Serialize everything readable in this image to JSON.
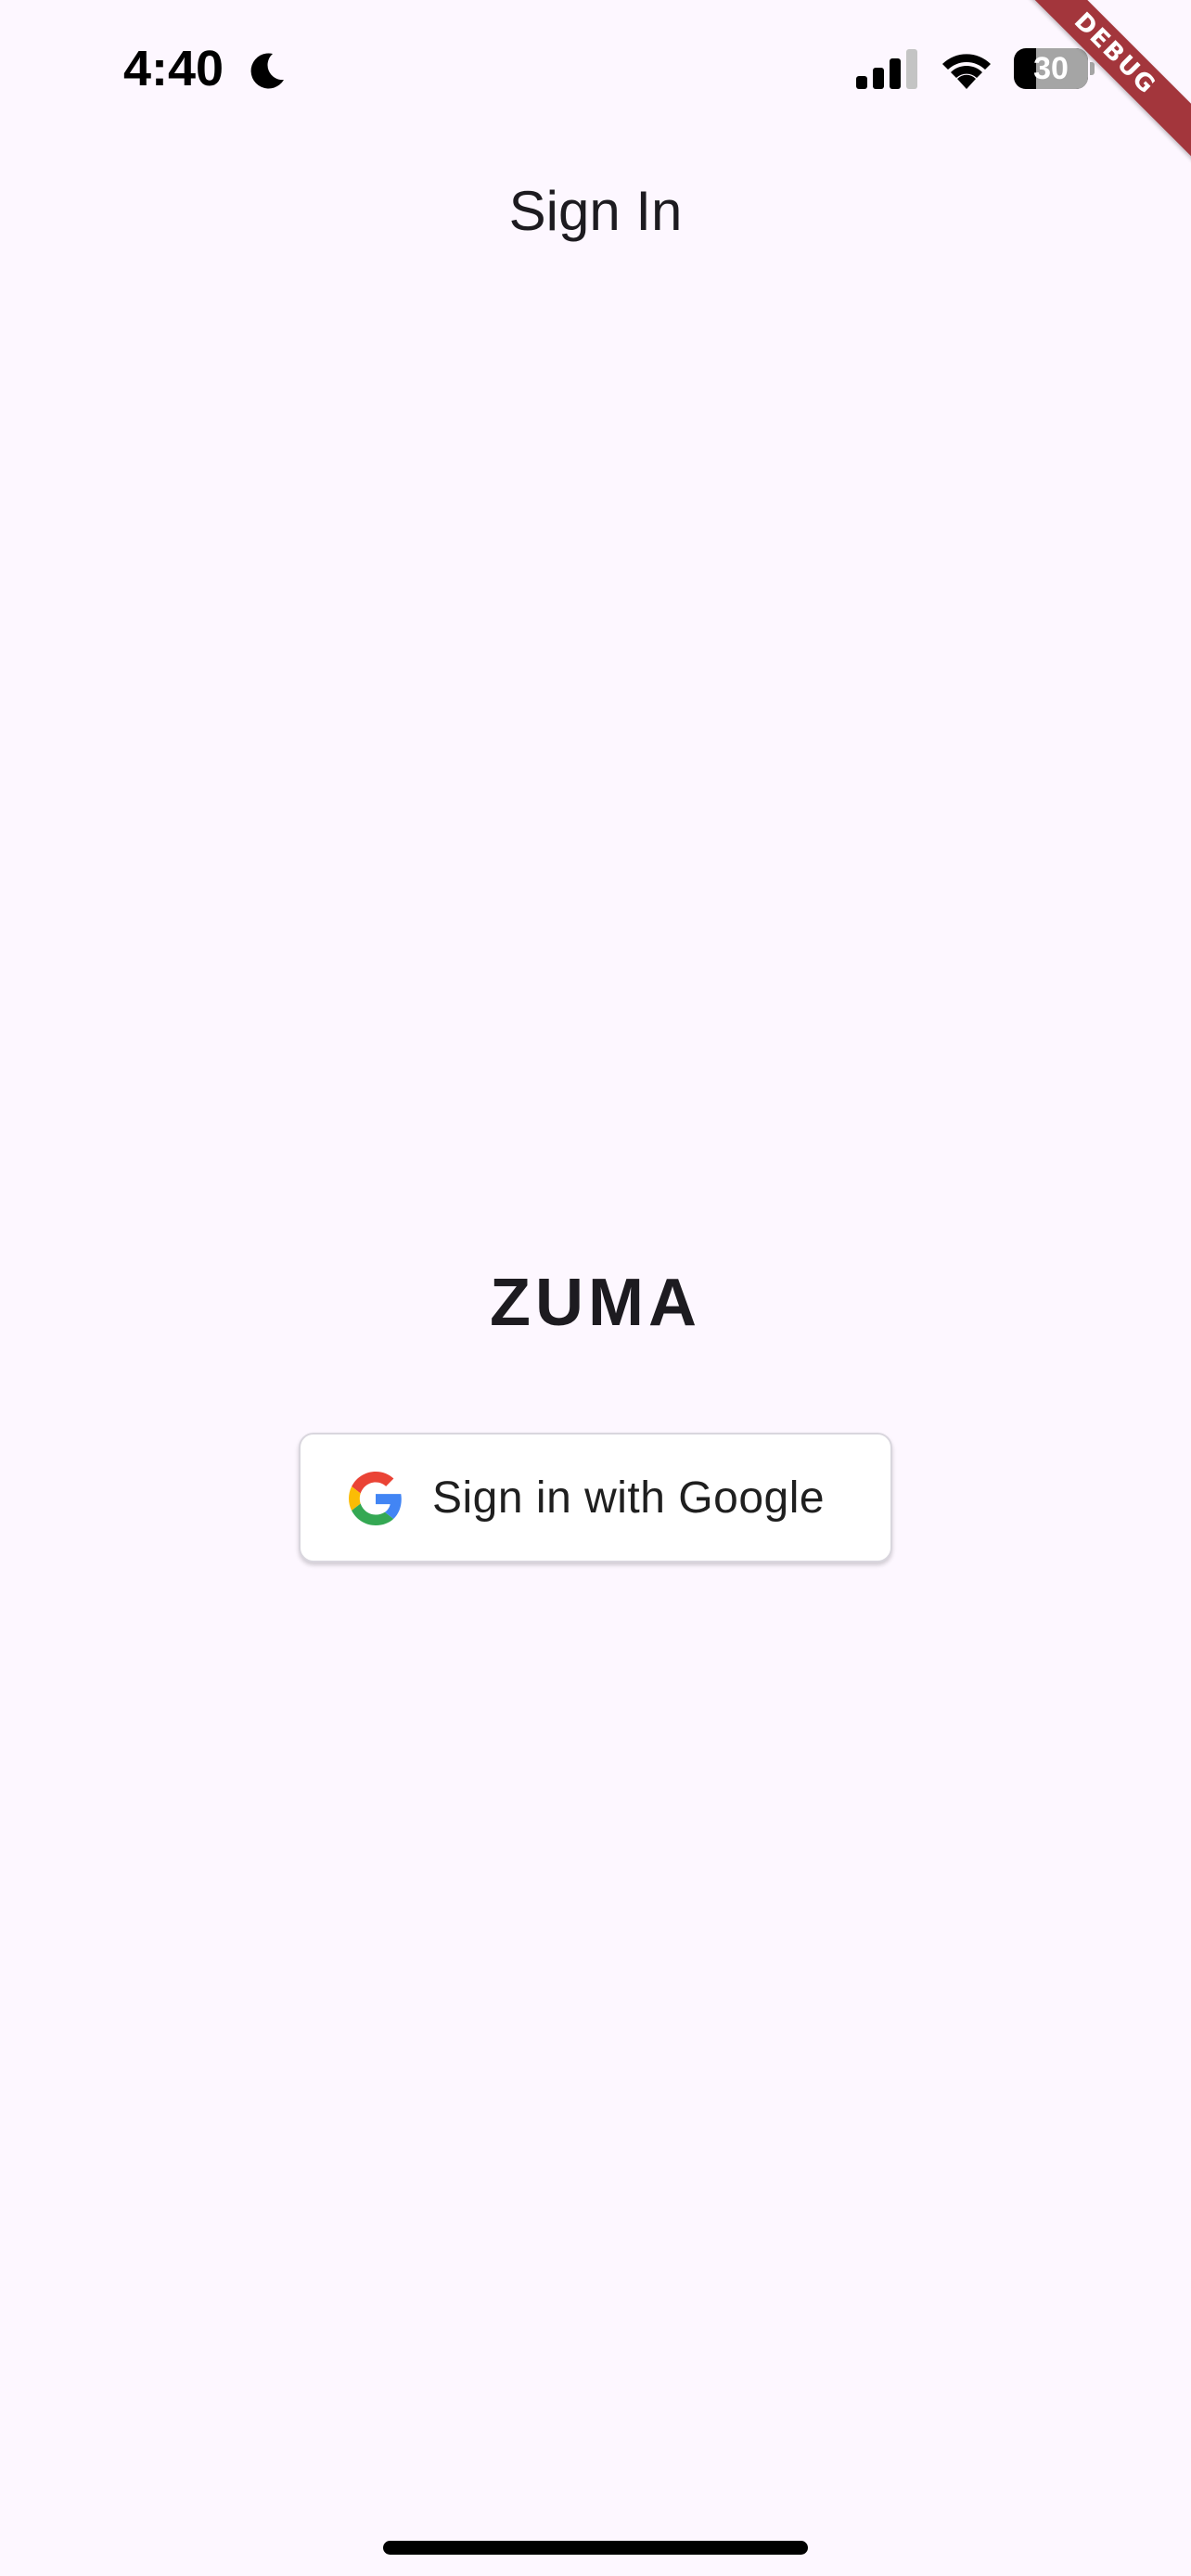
{
  "status_bar": {
    "time": "4:40",
    "battery_level": "30",
    "icons": [
      "moon-icon",
      "signal-icon",
      "wifi-icon",
      "battery-icon"
    ]
  },
  "debug_banner": {
    "label": "DEBUG",
    "color": "#a3363c"
  },
  "app_bar": {
    "title": "Sign In"
  },
  "main": {
    "app_name": "ZUMA",
    "google_button": {
      "label": "Sign in with Google",
      "icon": "google-logo-icon"
    }
  },
  "colors": {
    "background": "#fdf7ff",
    "text": "#1d1b20",
    "google_blue": "#4285f4",
    "google_red": "#ea4335",
    "google_yellow": "#fbbc05",
    "google_green": "#34a853"
  }
}
